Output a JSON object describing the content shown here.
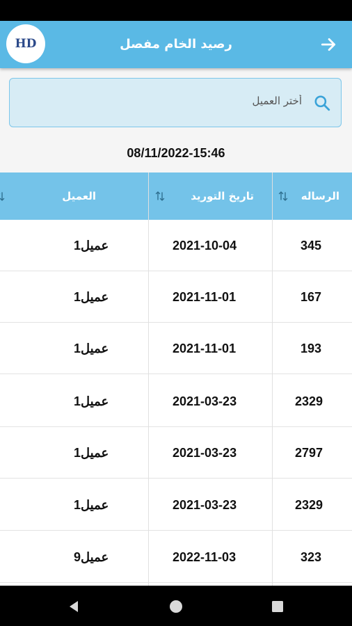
{
  "header": {
    "title": "رصيد الخام مفصل",
    "logo_text": "HD",
    "back_icon": "arrow-right-icon"
  },
  "search": {
    "placeholder": "أختر العميل",
    "icon": "search-icon"
  },
  "timestamp": "08/11/2022-15:46",
  "table": {
    "columns": [
      {
        "label": "الرساله"
      },
      {
        "label": "تاريخ التوريد"
      },
      {
        "label": "العميل"
      }
    ],
    "rows": [
      {
        "message": "345",
        "date": "2021-10-04",
        "client": "عميل1"
      },
      {
        "message": "167",
        "date": "2021-11-01",
        "client": "عميل1"
      },
      {
        "message": "193",
        "date": "2021-11-01",
        "client": "عميل1"
      },
      {
        "message": "2329",
        "date": "2021-03-23",
        "client": "عميل1"
      },
      {
        "message": "2797",
        "date": "2021-03-23",
        "client": "عميل1"
      },
      {
        "message": "2329",
        "date": "2021-03-23",
        "client": "عميل1"
      },
      {
        "message": "323",
        "date": "2022-11-03",
        "client": "عميل9"
      }
    ]
  },
  "colors": {
    "app_bar": "#5ab9e5",
    "table_header": "#74c3e9",
    "search_bg": "#d7ecf5"
  }
}
